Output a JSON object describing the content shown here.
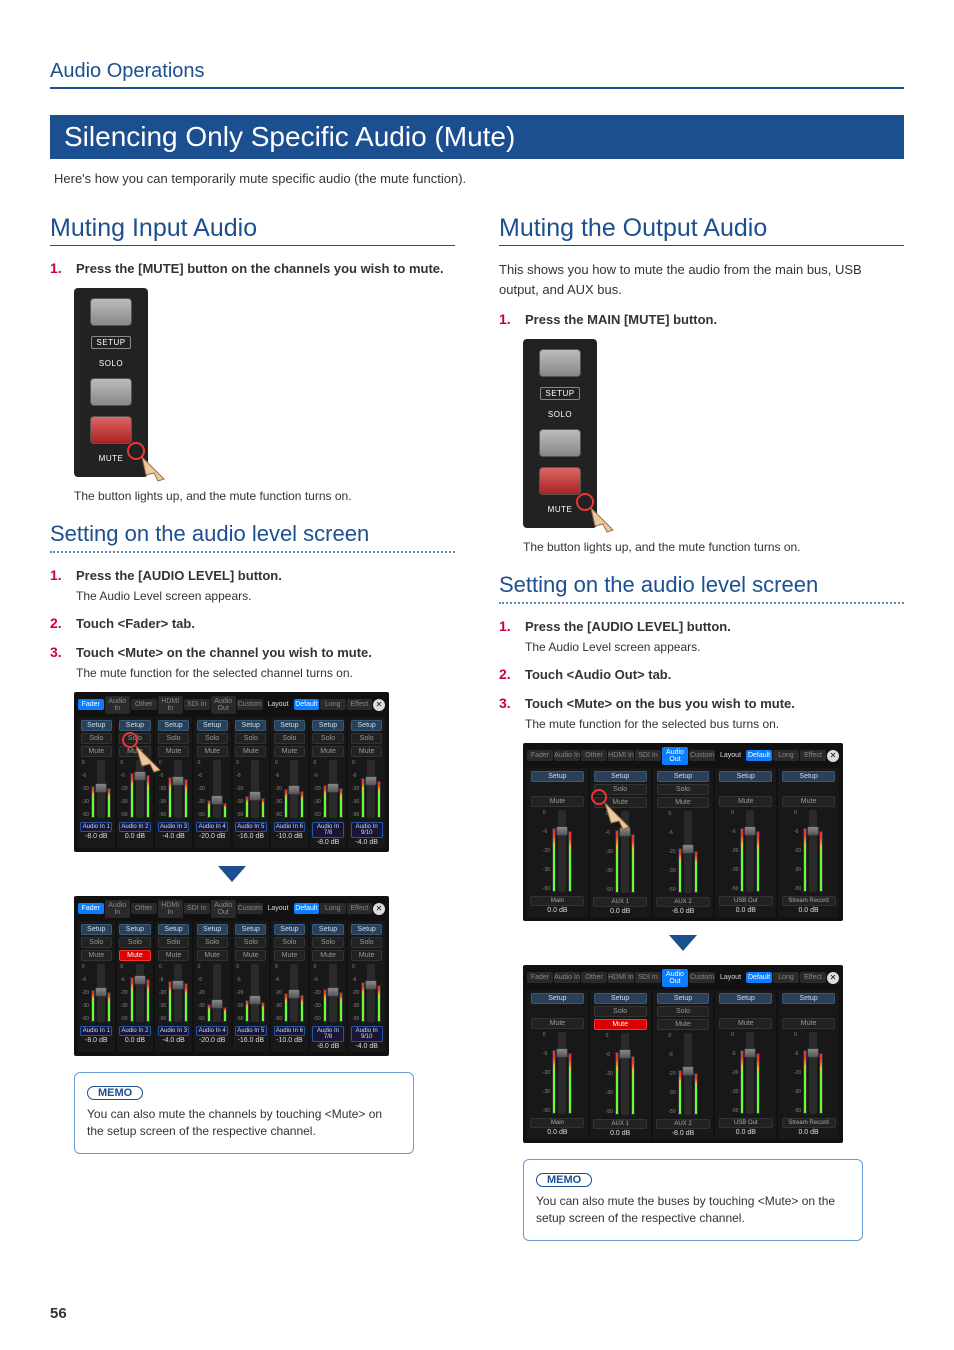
{
  "header": {
    "section": "Audio Operations"
  },
  "title": "Silencing Only Specific Audio (Mute)",
  "intro": "Here's how you can temporarily mute specific audio (the mute function).",
  "page_number": "56",
  "left": {
    "heading": "Muting Input Audio",
    "step1": "Press the [MUTE] button on the channels you wish to mute.",
    "caption1": "The button lights up, and the mute function turns on.",
    "sub_heading": "Setting on the audio level screen",
    "s1": "Press the [AUDIO LEVEL] button.",
    "s1_sub": "The Audio Level screen appears.",
    "s2": "Touch <Fader> tab.",
    "s3": "Touch <Mute> on the channel you wish to mute.",
    "s3_sub": "The mute function for the selected channel turns on.",
    "memo_label": "MEMO",
    "memo": "You can also mute the channels by touching <Mute> on the setup screen of the respective channel."
  },
  "right": {
    "heading": "Muting the Output Audio",
    "intro": "This shows you how to mute the audio from the main bus, USB output, and AUX bus.",
    "step1": "Press the MAIN [MUTE] button.",
    "caption1": "The button lights up, and the mute function turns on.",
    "sub_heading": "Setting on the audio level screen",
    "s1": "Press the [AUDIO LEVEL] button.",
    "s1_sub": "The Audio Level screen appears.",
    "s2": "Touch <Audio Out> tab.",
    "s3": "Touch <Mute> on the bus you wish to mute.",
    "s3_sub": "The mute function for the selected bus turns on.",
    "memo_label": "MEMO",
    "memo": "You can also mute the buses by touching <Mute> on the setup screen of the respective channel."
  },
  "panel": {
    "setup": "SETUP",
    "solo": "SOLO",
    "mute": "MUTE"
  },
  "screen": {
    "tabs": {
      "fader": "Fader",
      "audio_in": "Audio In",
      "other": "Other",
      "hdmi_in": "HDMI In",
      "sdi_in": "SDI In",
      "audio_out": "Audio Out",
      "custom": "Custom",
      "layout": "Layout",
      "default": "Default",
      "long": "Long",
      "effect": "Effect"
    },
    "btns": {
      "setup": "Setup",
      "solo": "Solo",
      "mute": "Mute"
    },
    "scale": {
      "t0": "0",
      "t6": "-6",
      "t20": "-20",
      "t30": "-30",
      "t50": "-50"
    },
    "in_channels": [
      {
        "name": "Audio In 1",
        "db": "-8.0 dB",
        "bar": 55,
        "knob": 40
      },
      {
        "name": "Audio In 2",
        "db": "0.0 dB",
        "bar": 78,
        "knob": 20
      },
      {
        "name": "Audio In 3",
        "db": "-4.0 dB",
        "bar": 70,
        "knob": 28
      },
      {
        "name": "Audio In 4",
        "db": "-20.0 dB",
        "bar": 30,
        "knob": 60
      },
      {
        "name": "Audio In 5",
        "db": "-16.0 dB",
        "bar": 38,
        "knob": 54
      },
      {
        "name": "Audio In 6",
        "db": "-10.0 dB",
        "bar": 50,
        "knob": 44
      },
      {
        "name": "Audio In 7/8",
        "db": "-8.0 dB",
        "bar": 56,
        "knob": 40
      },
      {
        "name": "Audio In 9/10",
        "db": "-4.0 dB",
        "bar": 68,
        "knob": 28
      }
    ],
    "out_channels": [
      {
        "name": "Main",
        "db": "0.0 dB",
        "bar": 78,
        "knob": 20,
        "solo": false
      },
      {
        "name": "AUX 1",
        "db": "0.0 dB",
        "bar": 76,
        "knob": 20,
        "solo": true
      },
      {
        "name": "AUX 2",
        "db": "-8.0 dB",
        "bar": 55,
        "knob": 40,
        "solo": true
      },
      {
        "name": "USB Out",
        "db": "0.0 dB",
        "bar": 78,
        "knob": 20,
        "solo": false
      },
      {
        "name": "Stream Record",
        "db": "0.0 dB",
        "bar": 78,
        "knob": 20,
        "solo": false
      }
    ]
  }
}
